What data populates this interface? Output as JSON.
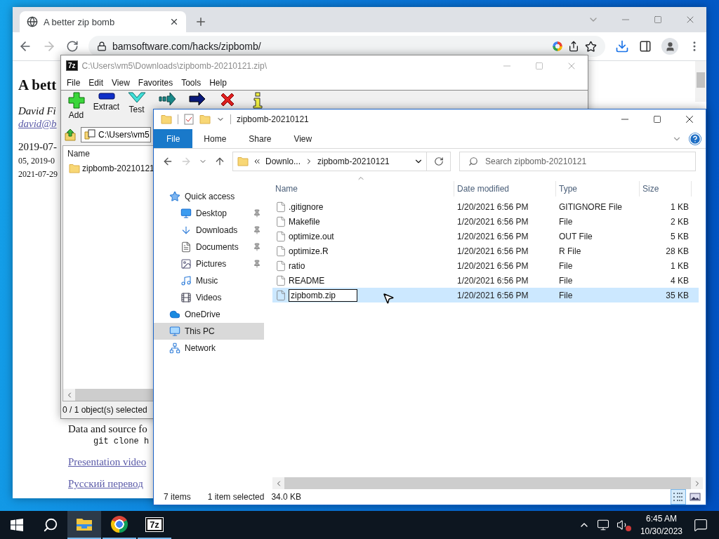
{
  "browser": {
    "tab_title": "A better zip bomb",
    "url": "bamsoftware.com/hacks/zipbomb/",
    "page": {
      "heading": "A bett",
      "author": "David Fi",
      "email": "david@b",
      "dates": [
        "2019-07-",
        "05, 2019-0",
        "2021-07-29"
      ],
      "source_text": "Data and source fo",
      "command": "git clone h",
      "links": [
        "Presentation video",
        "Русский перевод"
      ]
    }
  },
  "archiver": {
    "logo": "7z",
    "title": "C:\\Users\\vm5\\Downloads\\zipbomb-20210121.zip\\",
    "menu": [
      "File",
      "Edit",
      "View",
      "Favorites",
      "Tools",
      "Help"
    ],
    "toolbar": [
      {
        "kind": "add",
        "label": "Add"
      },
      {
        "kind": "extract",
        "label": "Extract"
      },
      {
        "kind": "test",
        "label": "Test"
      },
      {
        "kind": "copy"
      },
      {
        "kind": "move"
      },
      {
        "kind": "delete"
      },
      {
        "kind": "info"
      }
    ],
    "path": "C:\\Users\\vm5",
    "column": "Name",
    "items": [
      "zipbomb-20210121"
    ],
    "status": "0 / 1 object(s) selected"
  },
  "explorer": {
    "title": "zipbomb-20210121",
    "ribbon_tabs": [
      {
        "label": "File",
        "selected": true
      },
      {
        "label": "Home",
        "selected": false
      },
      {
        "label": "Share",
        "selected": false
      },
      {
        "label": "View",
        "selected": false
      }
    ],
    "breadcrumb": [
      "Downlo...",
      "zipbomb-20210121"
    ],
    "search_placeholder": "Search zipbomb-20210121",
    "nav": [
      {
        "kind": "star",
        "label": "Quick access",
        "selected": false,
        "children": [
          {
            "kind": "desktop",
            "label": "Desktop",
            "pinned": true,
            "selected": false
          },
          {
            "kind": "downloads",
            "label": "Downloads",
            "pinned": true,
            "selected": false
          },
          {
            "kind": "documents",
            "label": "Documents",
            "pinned": true,
            "selected": false
          },
          {
            "kind": "pictures",
            "label": "Pictures",
            "pinned": true,
            "selected": false
          },
          {
            "kind": "music",
            "label": "Music",
            "pinned": false,
            "selected": false
          },
          {
            "kind": "videos",
            "label": "Videos",
            "pinned": false,
            "selected": false
          }
        ]
      },
      {
        "kind": "cloud",
        "label": "OneDrive",
        "selected": false
      },
      {
        "kind": "pc",
        "label": "This PC",
        "selected": true
      },
      {
        "kind": "network",
        "label": "Network",
        "selected": false
      }
    ],
    "columns": [
      "Name",
      "Date modified",
      "Type",
      "Size"
    ],
    "files": [
      {
        "name": ".gitignore",
        "date": "1/20/2021 6:56 PM",
        "type": "GITIGNORE File",
        "size": "1 KB",
        "selected": false,
        "renaming": false
      },
      {
        "name": "Makefile",
        "date": "1/20/2021 6:56 PM",
        "type": "File",
        "size": "2 KB",
        "selected": false,
        "renaming": false
      },
      {
        "name": "optimize.out",
        "date": "1/20/2021 6:56 PM",
        "type": "OUT File",
        "size": "5 KB",
        "selected": false,
        "renaming": false
      },
      {
        "name": "optimize.R",
        "date": "1/20/2021 6:56 PM",
        "type": "R File",
        "size": "28 KB",
        "selected": false,
        "renaming": false
      },
      {
        "name": "ratio",
        "date": "1/20/2021 6:56 PM",
        "type": "File",
        "size": "1 KB",
        "selected": false,
        "renaming": false
      },
      {
        "name": "README",
        "date": "1/20/2021 6:56 PM",
        "type": "File",
        "size": "4 KB",
        "selected": false,
        "renaming": false
      },
      {
        "name": "zipbomb.zip",
        "date": "1/20/2021 6:56 PM",
        "type": "File",
        "size": "35 KB",
        "selected": true,
        "renaming": true
      }
    ],
    "status": {
      "count": "7 items",
      "selection": "1 item selected",
      "size": "34.0 KB"
    },
    "views": [
      {
        "kind": "details",
        "selected": true
      },
      {
        "kind": "tiles",
        "selected": false
      }
    ]
  },
  "taskbar": {
    "apps": [
      {
        "kind": "explorer",
        "selected": true
      },
      {
        "kind": "chrome",
        "selected": false
      },
      {
        "kind": "archiver",
        "label": "7z",
        "selected": false
      }
    ],
    "time": "6:45 AM",
    "date": "10/30/2023"
  }
}
